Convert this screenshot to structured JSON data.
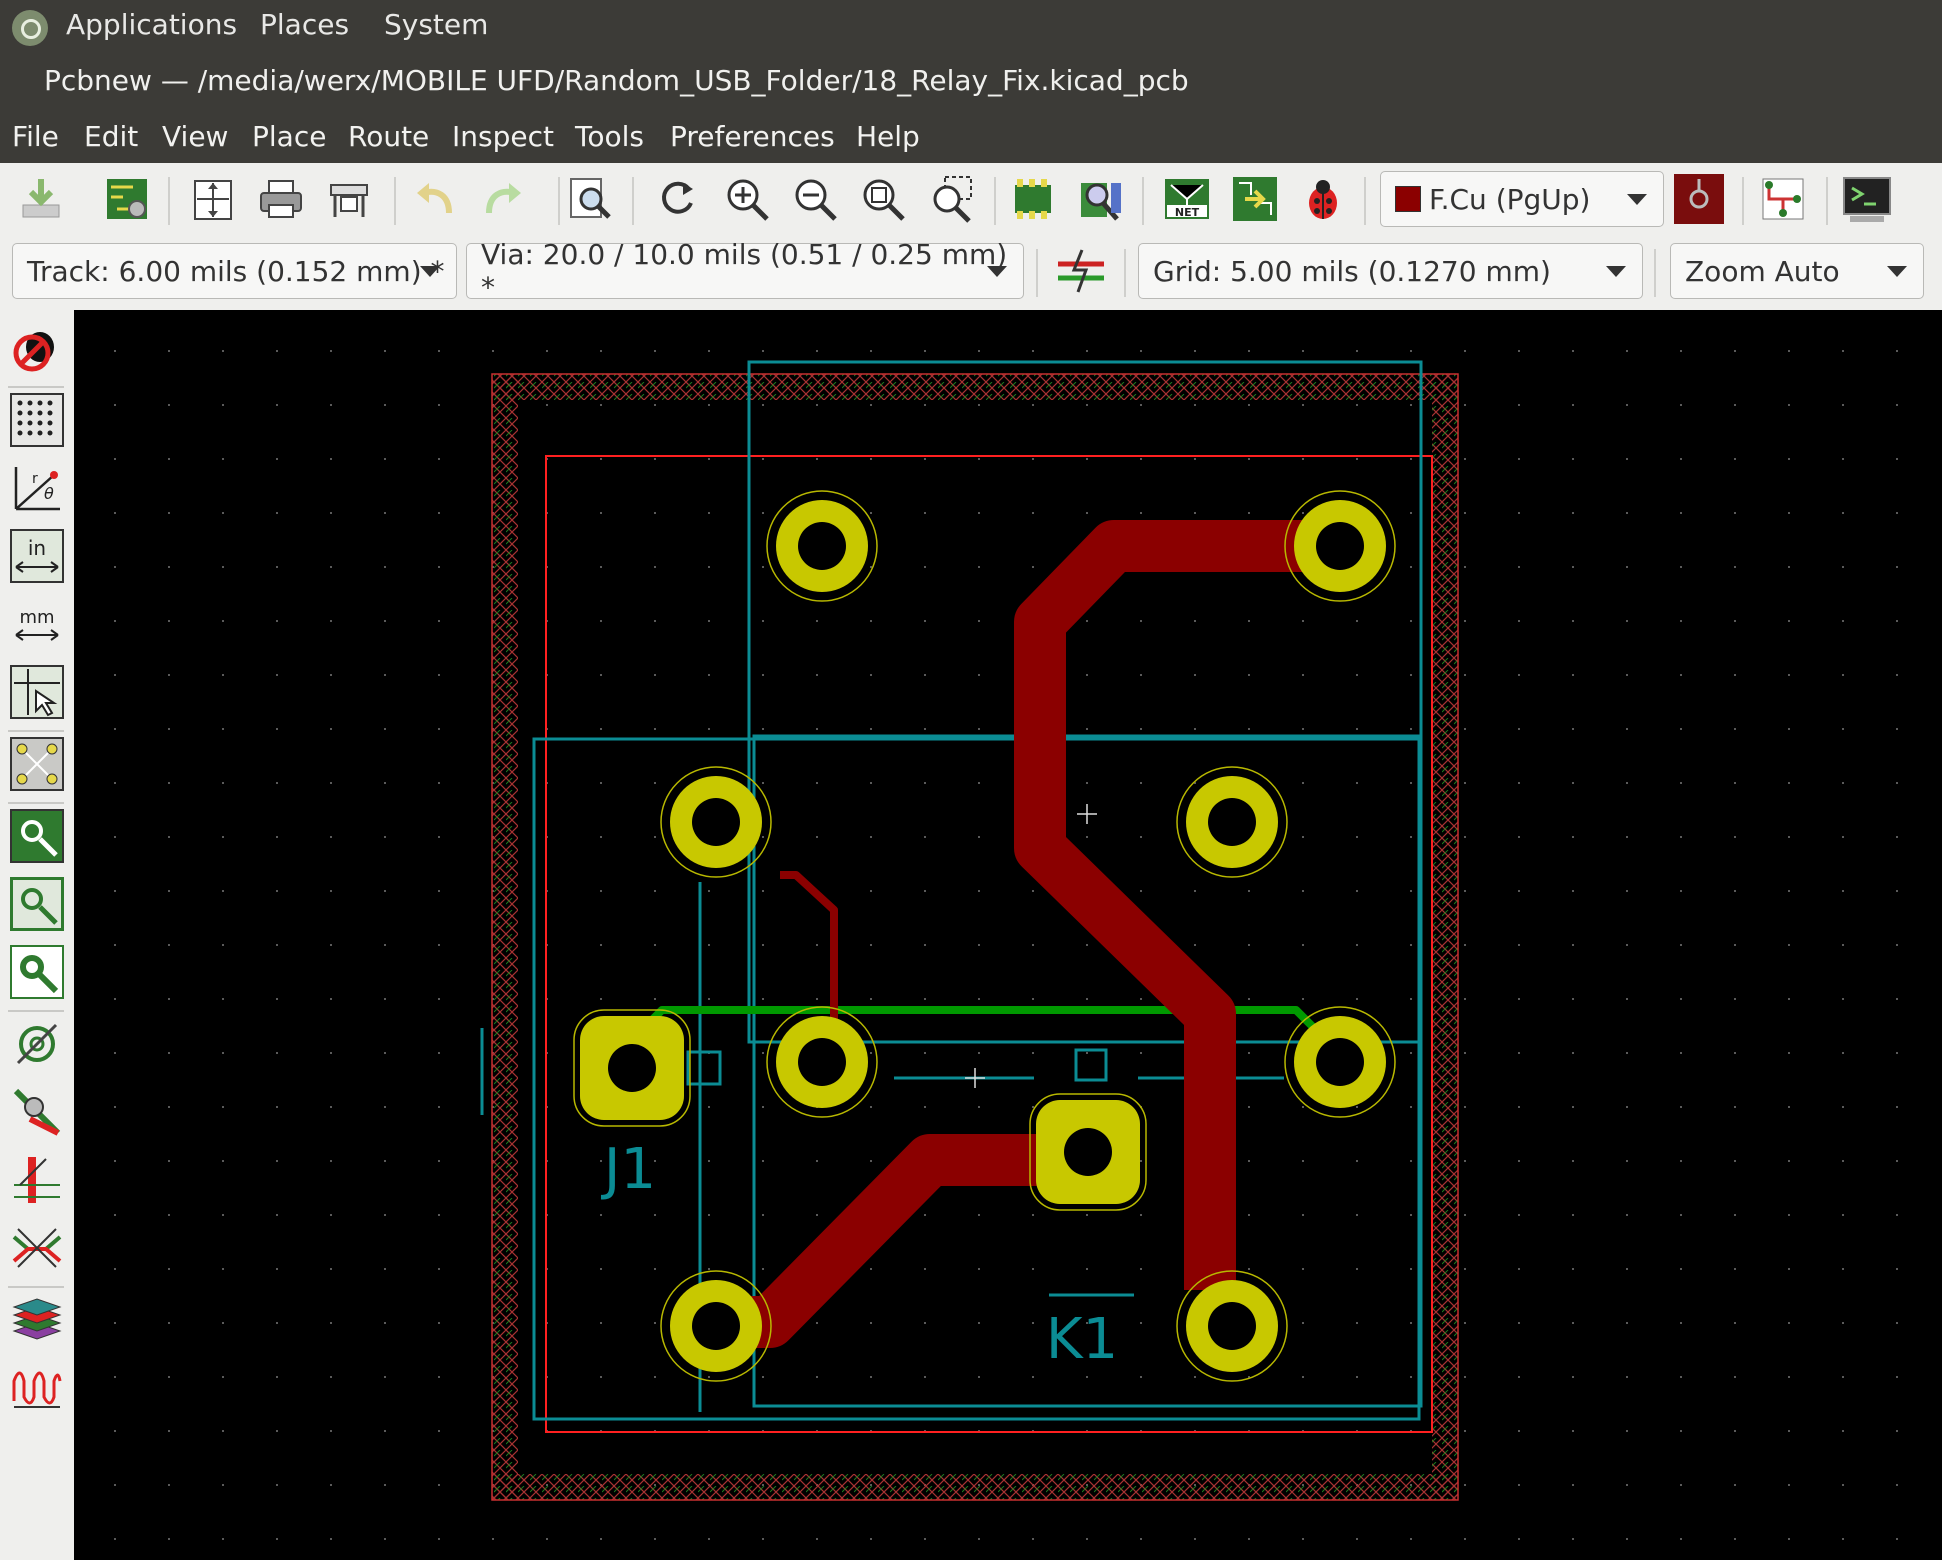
{
  "topbar": {
    "menus": [
      "Applications",
      "Places",
      "System"
    ]
  },
  "window": {
    "title": "Pcbnew — /media/werx/MOBILE UFD/Random_USB_Folder/18_Relay_Fix.kicad_pcb"
  },
  "menubar": {
    "items": [
      "File",
      "Edit",
      "View",
      "Place",
      "Route",
      "Inspect",
      "Tools",
      "Preferences",
      "Help"
    ]
  },
  "toolbar": {
    "layer_select": "F.Cu (PgUp)",
    "track_select": "Track: 6.00 mils (0.152 mm) *",
    "via_select": "Via: 20.0 / 10.0 mils (0.51 / 0.25 mm) *",
    "grid_select": "Grid: 5.00 mils (0.1270 mm)",
    "zoom_select": "Zoom Auto"
  },
  "pcb": {
    "ref_j1": "J1",
    "ref_k1": "K1",
    "colors": {
      "copper_front": "#8b0000",
      "copper_back": "#009900",
      "pad": "#c8c800",
      "courtyard": "#0b8c94",
      "edge": "#ff2020"
    }
  }
}
